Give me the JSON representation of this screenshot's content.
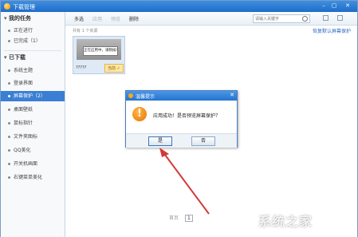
{
  "window": {
    "title": "下载管理"
  },
  "sidebar": {
    "section_tasks": "我的任务",
    "task_items": [
      {
        "label": "正在进行"
      },
      {
        "label": "已完成（1）"
      }
    ],
    "section_downloaded": "已下载",
    "items": [
      {
        "label": "系统主题"
      },
      {
        "label": "登录界面"
      },
      {
        "label": "屏幕保护（2）",
        "selected": true
      },
      {
        "label": "桌面壁纸"
      },
      {
        "label": "鼠标指针"
      },
      {
        "label": "文件夹图标"
      },
      {
        "label": "QQ美化"
      },
      {
        "label": "开关机画面"
      },
      {
        "label": "右键菜单美化"
      }
    ]
  },
  "toolbar": {
    "buttons": [
      {
        "label": "多选",
        "enabled": true
      },
      {
        "label": "应用",
        "enabled": false
      },
      {
        "label": "预览",
        "enabled": false
      },
      {
        "label": "删除",
        "enabled": true
      }
    ],
    "search_placeholder": "请输入关键字"
  },
  "content": {
    "count_text": "共有 1 个资源",
    "set_default_link": "恢复默认屏幕保护",
    "items": [
      {
        "thumb_text": "正在应用中，请稍候!",
        "name": "?????",
        "tag": "当前 ✓"
      }
    ],
    "pager": {
      "prev": "首页",
      "current": "1"
    }
  },
  "dialog": {
    "title": "温馨提示",
    "message": "应用成功！是否预览屏幕保护？",
    "yes_label": "是",
    "no_label": "否"
  },
  "watermark": {
    "text": "系统之家"
  },
  "colors": {
    "accent": "#3a7fd4",
    "titlebar": "#1e6cc8",
    "arrow": "#d33a3a"
  }
}
